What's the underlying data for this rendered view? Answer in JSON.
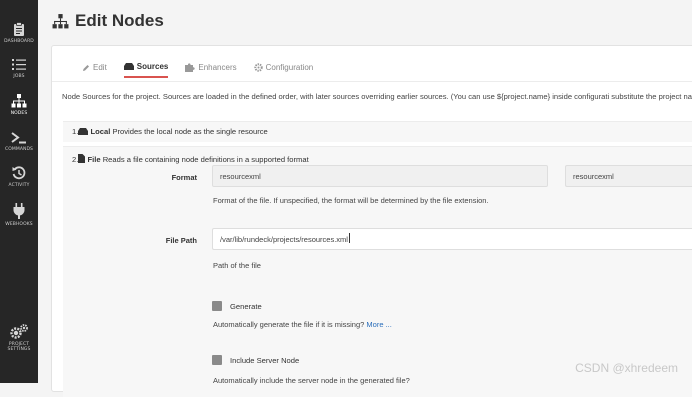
{
  "sidebar": {
    "items": [
      {
        "label": "DASHBOARD",
        "icon": "clipboard-icon"
      },
      {
        "label": "JOBS",
        "icon": "list-icon"
      },
      {
        "label": "NODES",
        "icon": "sitemap-icon"
      },
      {
        "label": "COMMANDS",
        "icon": "terminal-icon"
      },
      {
        "label": "ACTIVITY",
        "icon": "history-icon"
      },
      {
        "label": "WEBHOOKS",
        "icon": "plug-icon"
      }
    ],
    "bottom": {
      "label": "PROJECT SETTINGS",
      "label_line1": "PROJECT",
      "label_line2": "SETTINGS",
      "icon": "gears-icon"
    }
  },
  "header": {
    "title": "Edit Nodes"
  },
  "tabs": [
    {
      "label": "Edit",
      "icon": "pencil-icon",
      "active": false
    },
    {
      "label": "Sources",
      "icon": "server-icon",
      "active": true
    },
    {
      "label": "Enhancers",
      "icon": "puzzle-icon",
      "active": false
    },
    {
      "label": "Configuration",
      "icon": "gear-icon",
      "active": false
    }
  ],
  "description": "Node Sources for the project. Sources are loaded in the defined order, with later sources overriding earlier sources. (You can use ${project.name} inside configurati substitute the project name.)",
  "sources": [
    {
      "num": "1.",
      "name": "Local",
      "desc": "Provides the local node as the single resource"
    },
    {
      "num": "2.",
      "name": "File",
      "desc": "Reads a file containing node definitions in a supported format"
    }
  ],
  "form": {
    "format": {
      "label": "Format",
      "value": "resourcexml",
      "value2": "resourcexml",
      "help": "Format of the file. If unspecified, the format will be determined by the file extension."
    },
    "file_path": {
      "label": "File Path",
      "value": "/var/lib/rundeck/projects/resources.xml",
      "help": "Path of the file"
    },
    "generate": {
      "label": "Generate",
      "help": "Automatically generate the file if it is missing?",
      "more": "More ..."
    },
    "include_server_node": {
      "label": "Include Server Node",
      "help": "Automatically include the server node in the generated file?"
    }
  },
  "watermark": "CSDN @xhredeem",
  "colors": {
    "sidebar_bg": "#262626",
    "accent": "#d9534f",
    "link": "#2a6ebb"
  }
}
